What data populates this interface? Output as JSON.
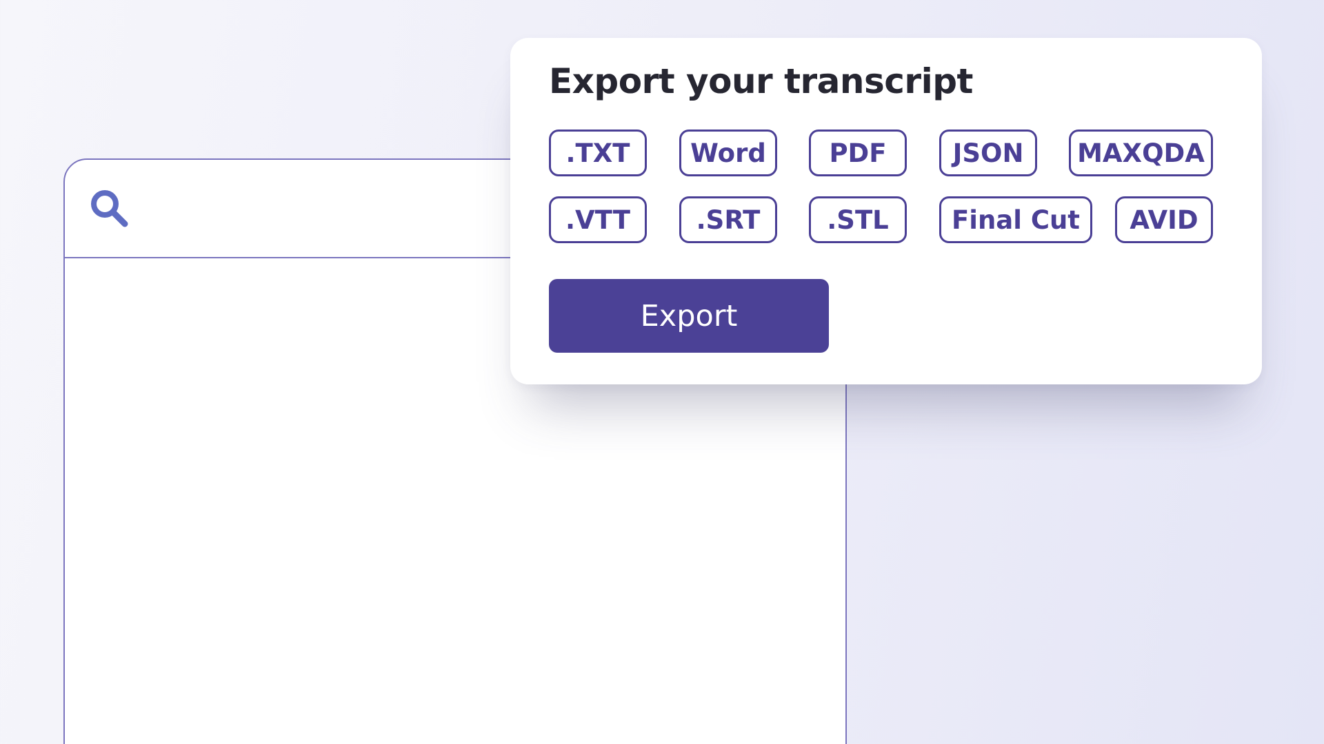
{
  "export_panel": {
    "title": "Export your transcript",
    "formats_row1": [
      ".TXT",
      "Word",
      "PDF",
      "JSON",
      "MAXQDA"
    ],
    "formats_row2": [
      ".VTT",
      ".SRT",
      ".STL",
      "Final Cut",
      "AVID"
    ],
    "export_label": "Export"
  },
  "search": {
    "icon": "search-icon"
  },
  "colors": {
    "accent": "#4b4196",
    "chip_border": "#4a3f95",
    "window_border": "#7a74be",
    "search_icon": "#5e6cc2"
  }
}
